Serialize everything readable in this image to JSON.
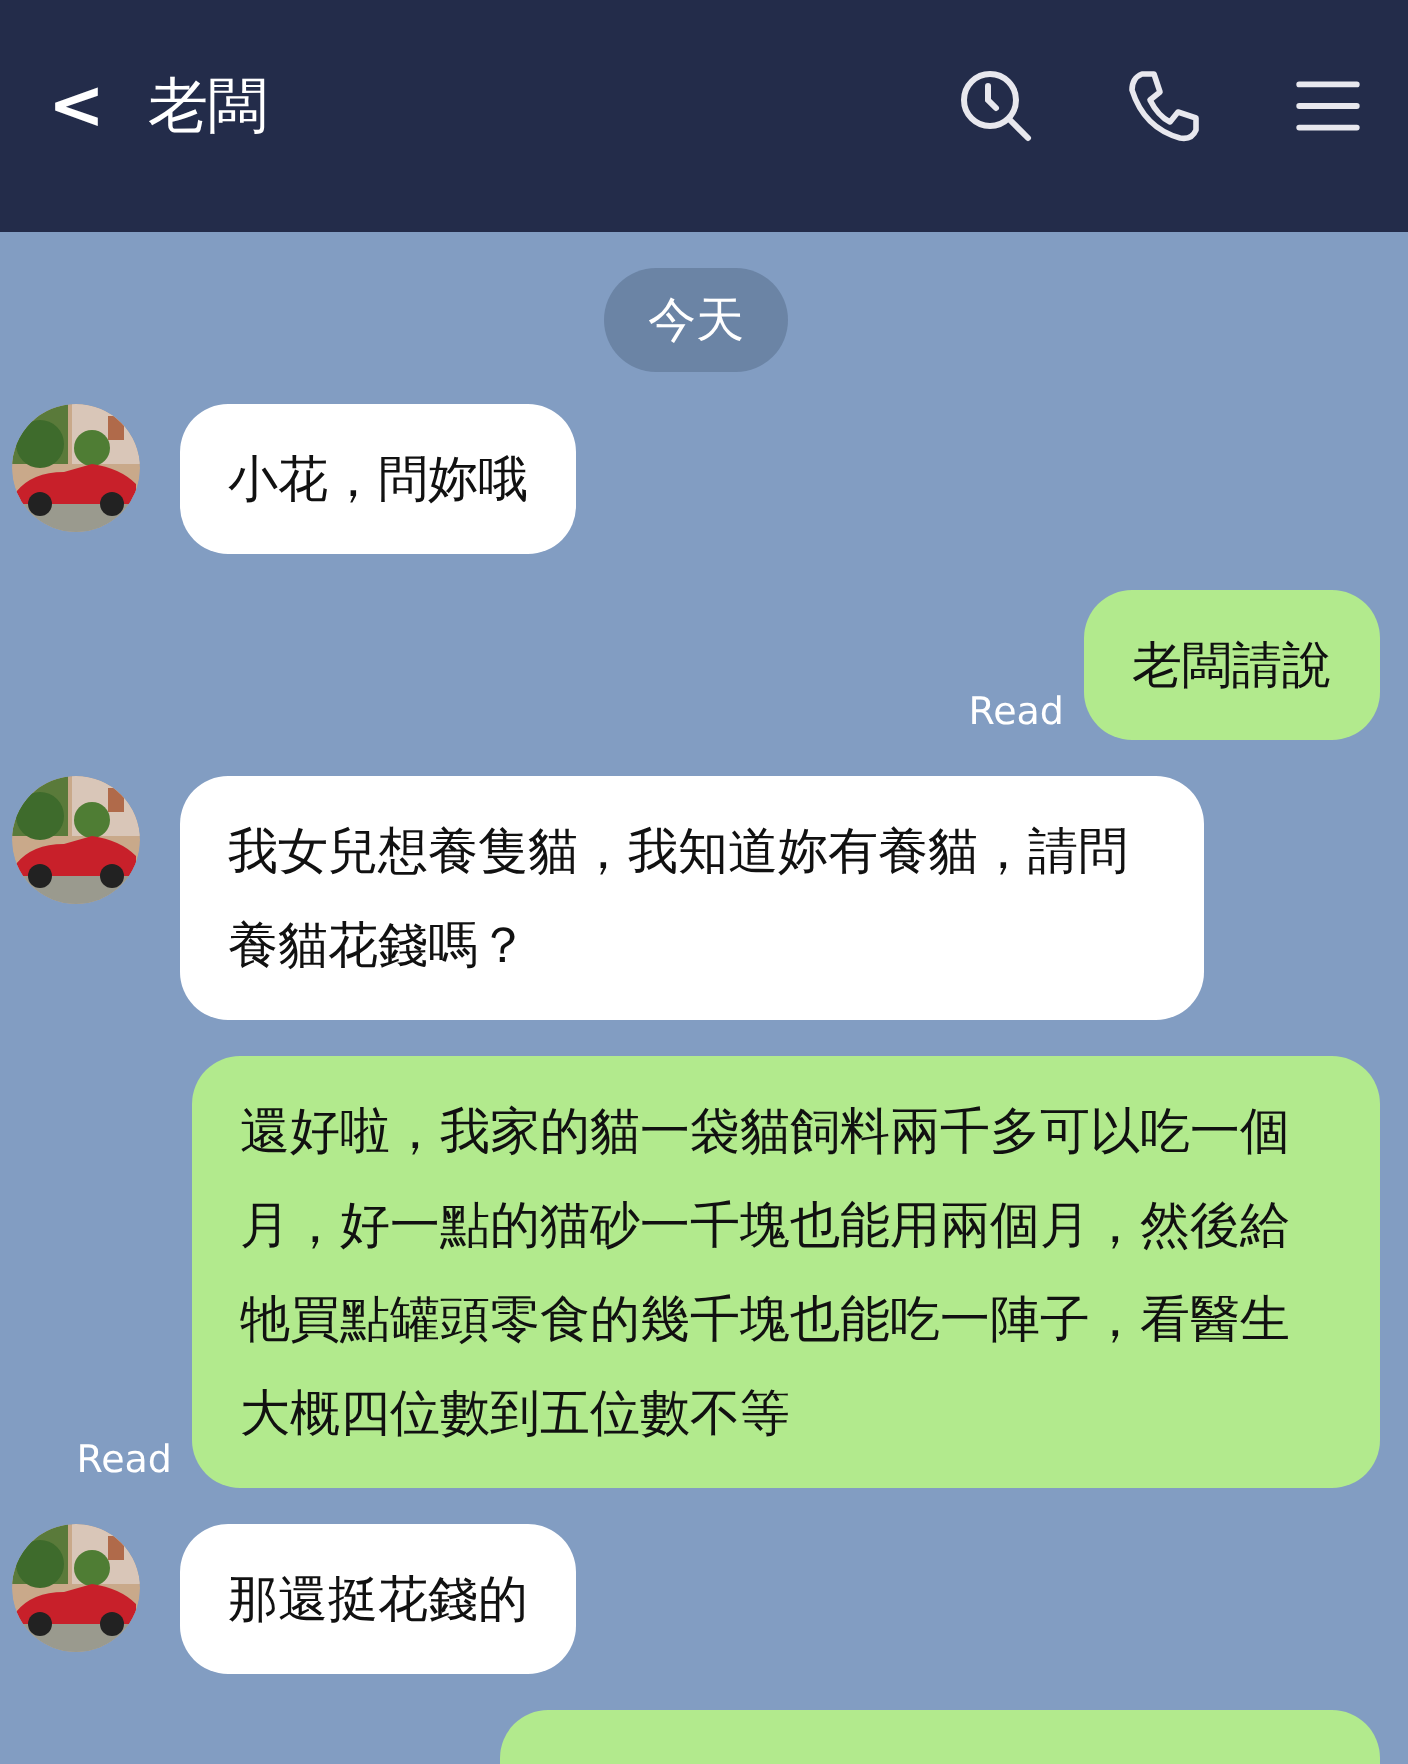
{
  "header": {
    "back": "<",
    "title": "老闆"
  },
  "date_label": "今天",
  "messages": [
    {
      "kind": "incoming",
      "text": "小花，問妳哦"
    },
    {
      "kind": "outgoing",
      "text": "老闆請說",
      "status": "Read"
    },
    {
      "kind": "incoming",
      "text": "我女兒想養隻貓，我知道妳有養貓，請問養貓花錢嗎？"
    },
    {
      "kind": "outgoing",
      "text": "還好啦，我家的貓一袋貓飼料兩千多可以吃一個月，好一點的猫砂一千塊也能用兩個月，然後給牠買點罐頭零食的幾千塊也能吃一陣子，看醫生大概四位數到五位數不等",
      "status": "Read"
    },
    {
      "kind": "incoming",
      "text": "那還挺花錢的"
    },
    {
      "kind": "outgoing_cut"
    }
  ]
}
